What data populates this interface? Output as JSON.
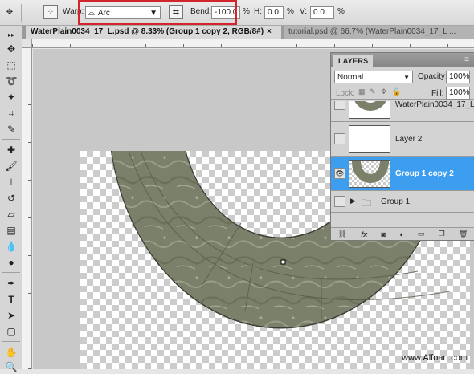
{
  "options_bar": {
    "warp_label": "Warp:",
    "warp_style": "Arc",
    "bend_label": "Bend:",
    "bend_value": "-100.0",
    "bend_unit": "%",
    "h_label": "H:",
    "h_value": "0.0",
    "h_unit": "%",
    "v_label": "V:",
    "v_value": "0.0",
    "v_unit": "%"
  },
  "tabs": [
    {
      "label": "WaterPlain0034_17_L.psd @ 8.33% (Group 1 copy 2, RGB/8#)",
      "close": "×"
    },
    {
      "label": "tutorial.psd @ 66.7% (WaterPlain0034_17_L ...",
      "close": ""
    }
  ],
  "watermark": "www.Alfoart.com",
  "layers_panel": {
    "title": "LAYERS",
    "blend_mode": "Normal",
    "opacity_label": "Opacity:",
    "opacity_value": "100%",
    "lock_label": "Lock:",
    "fill_label": "Fill:",
    "fill_value": "100%",
    "layers": [
      {
        "name": "WaterPlain0034_17_L...",
        "visible": false,
        "selected": false
      },
      {
        "name": "Layer 2",
        "visible": false,
        "selected": false
      },
      {
        "name": "Group 1 copy 2",
        "visible": true,
        "selected": true
      },
      {
        "name": "Group 1",
        "visible": false,
        "selected": false
      }
    ],
    "footer_fx": "fx"
  },
  "colors": {
    "selection": "#3d9ef0",
    "highlight_box": "#d3252b",
    "stone": "#7a8069"
  }
}
